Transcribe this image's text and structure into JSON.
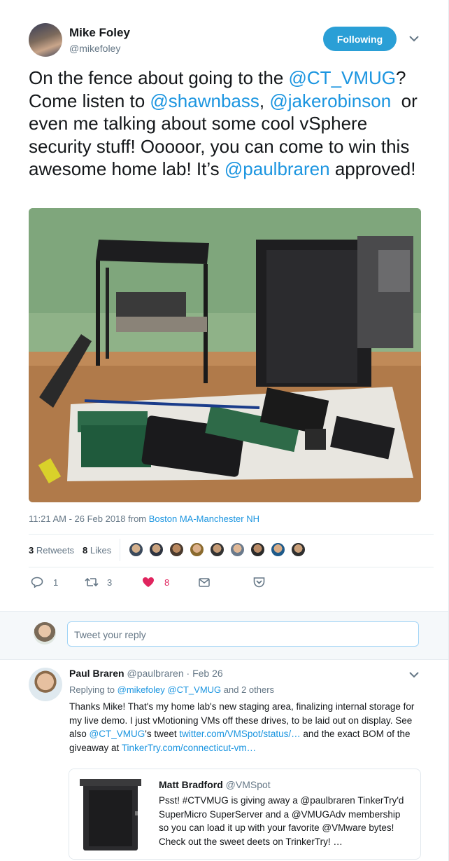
{
  "tweet": {
    "author_name": "Mike Foley",
    "author_handle": "@mikefoley",
    "follow_label": "Following",
    "text_parts": [
      {
        "t": "On the fence about going to the ",
        "link": false
      },
      {
        "t": "@CT_VMUG",
        "link": true
      },
      {
        "t": "? Come listen to ",
        "link": false
      },
      {
        "t": "@shawnbass",
        "link": true
      },
      {
        "t": ", ",
        "link": false
      },
      {
        "t": "@jakerobinson",
        "link": true
      },
      {
        "t": "  or even me talking about some cool vSphere security stuff! Ooooor, you can come to win this awesome home lab! It’s ",
        "link": false
      },
      {
        "t": "@paulbraren",
        "link": true
      },
      {
        "t": " approved!",
        "link": false
      }
    ],
    "timestamp": "11:21 AM - 26 Feb 2018 from ",
    "location": "Boston MA-Manchester NH",
    "retweets_count": "3",
    "retweets_label": "Retweets",
    "likes_count": "8",
    "likes_label": "Likes",
    "actions": {
      "reply": "1",
      "retweet": "3",
      "like": "8"
    }
  },
  "reply_box": {
    "placeholder": "Tweet your reply"
  },
  "reply": {
    "author_name": "Paul Braren",
    "author_handle": "@paulbraren",
    "date": "· Feb 26",
    "replying_to_prefix": "Replying to ",
    "replying_to_1": "@mikefoley",
    "replying_to_2": "@CT_VMUG",
    "replying_to_suffix": " and 2 others",
    "text_parts": [
      {
        "t": "Thanks Mike! That's my home lab's new staging area, finalizing internal storage for my live demo. I just vMotioning VMs off these drives, to be laid out on display. See also ",
        "link": false
      },
      {
        "t": "@CT_VMUG",
        "link": true
      },
      {
        "t": "'s tweet ",
        "link": false
      },
      {
        "t": "twitter.com/VMSpot/status/…",
        "link": true
      },
      {
        "t": " and the exact BOM of the giveaway at ",
        "link": false
      },
      {
        "t": "TinkerTry.com/connecticut-vm…",
        "link": true
      }
    ]
  },
  "quote": {
    "author_name": "Matt Bradford",
    "author_handle": "@VMSpot",
    "text": "Psst! #CTVMUG is giving away a @paulbraren TinkerTry'd SuperMicro SuperServer and a @VMUGAdv membership so you can load it up with your favorite @VMware bytes! Check out the sweet deets on TrinkerTry! …"
  },
  "colors": {
    "accent": "#1b95e0",
    "like": "#e0245e",
    "follow_bg": "#2a9fd6"
  }
}
